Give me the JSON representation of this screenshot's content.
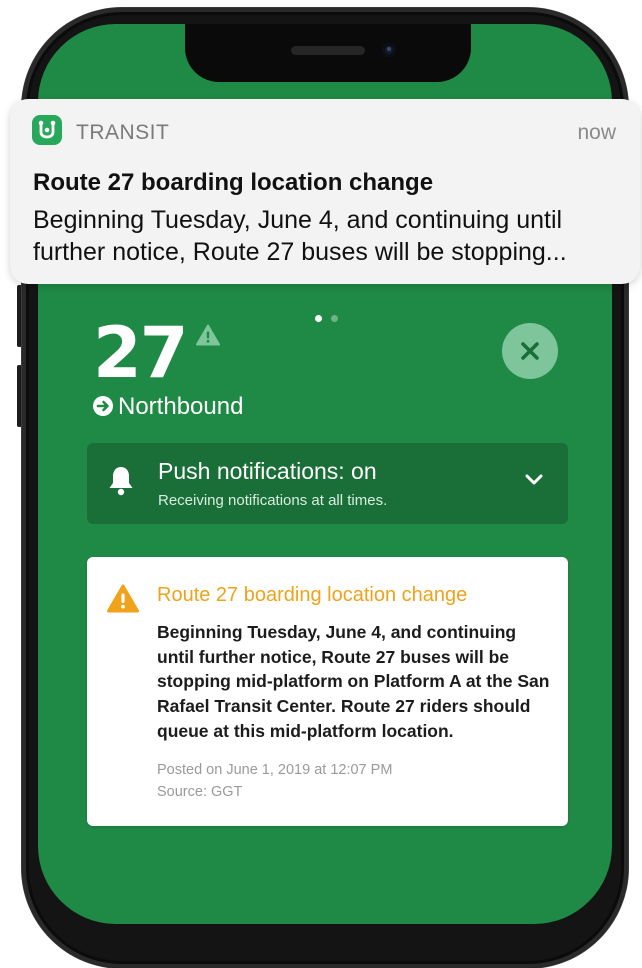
{
  "colors": {
    "screen_background": "#1f8a45",
    "push_card_background": "#1a6f39",
    "alert_title": "#f0a21a",
    "app_icon": "#27a85a",
    "close_button": "#7fc59b"
  },
  "notification": {
    "app_name": "TRANSIT",
    "time": "now",
    "title": "Route 27 boarding location change",
    "body": "Beginning Tuesday, June 4, and continuing until further notice, Route 27 buses will be stopping...",
    "icon": "transit-app-icon"
  },
  "route": {
    "number": "27",
    "direction": "Northbound",
    "page_count": 2,
    "current_page": 1
  },
  "push_settings": {
    "title": "Push notifications: on",
    "subtitle": "Receiving notifications at all times."
  },
  "alert": {
    "title": "Route 27 boarding location change",
    "body": "Beginning Tuesday, June 4, and continuing until further notice, Route 27 buses will be stopping mid-platform on Platform A at the San Rafael Transit Center. Route 27 riders should queue at this mid-platform location.",
    "posted": "Posted on June 1, 2019 at 12:07 PM",
    "source": "Source: GGT"
  }
}
